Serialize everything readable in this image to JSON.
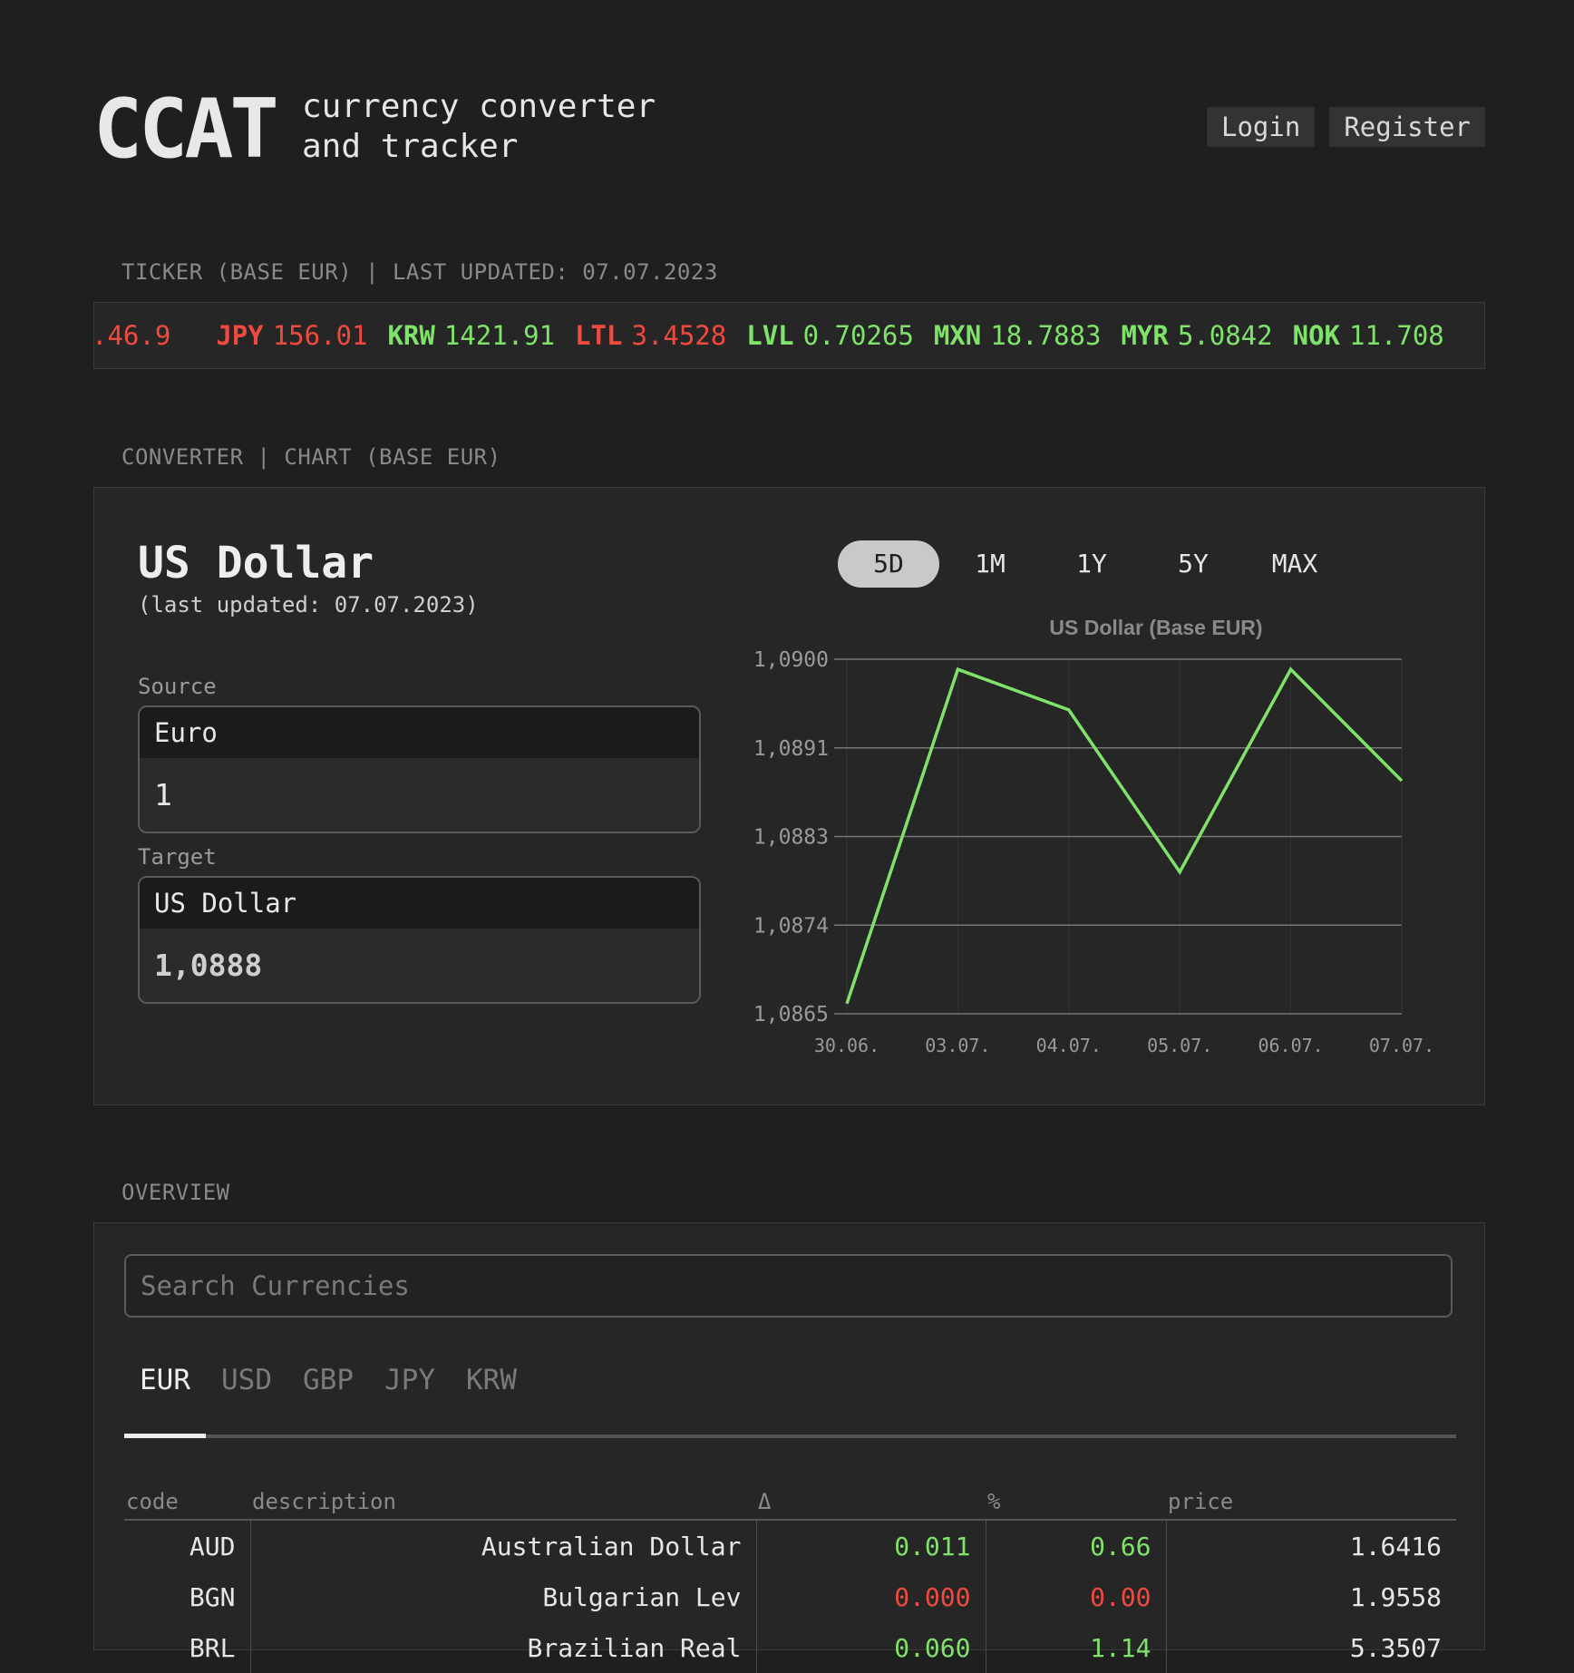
{
  "header": {
    "logo": "CCAT",
    "tagline_line1": "currency converter",
    "tagline_line2": "and tracker",
    "login_label": "Login",
    "register_label": "Register"
  },
  "ticker": {
    "label": "TICKER (BASE EUR) | LAST UPDATED: 07.07.2023",
    "items": [
      {
        "code": "",
        "rate": ".46.9",
        "trend": "down"
      },
      {
        "code": "JPY",
        "rate": "156.01",
        "trend": "down"
      },
      {
        "code": "KRW",
        "rate": "1421.91",
        "trend": "up"
      },
      {
        "code": "LTL",
        "rate": "3.4528",
        "trend": "down"
      },
      {
        "code": "LVL",
        "rate": "0.70265",
        "trend": "up"
      },
      {
        "code": "MXN",
        "rate": "18.7883",
        "trend": "up"
      },
      {
        "code": "MYR",
        "rate": "5.0842",
        "trend": "up"
      },
      {
        "code": "NOK",
        "rate": "11.708",
        "trend": "up"
      }
    ]
  },
  "converter": {
    "label": "CONVERTER | CHART (BASE EUR)",
    "title": "US Dollar",
    "updated": "(last updated: 07.07.2023)",
    "source_label": "Source",
    "source_currency": "Euro",
    "source_amount": "1",
    "target_label": "Target",
    "target_currency": "US Dollar",
    "target_amount": "1,0888",
    "range_tabs": [
      "5D",
      "1M",
      "1Y",
      "5Y",
      "MAX"
    ],
    "active_range": "5D"
  },
  "chart_data": {
    "type": "line",
    "title": "US Dollar (Base EUR)",
    "x": [
      "30.06.",
      "03.07.",
      "04.07.",
      "05.07.",
      "06.07.",
      "07.07."
    ],
    "series": [
      {
        "values": [
          1.0866,
          1.0899,
          1.0895,
          1.0879,
          1.0899,
          1.0888
        ]
      }
    ],
    "ylim": [
      1.0865,
      1.09
    ],
    "yticks": [
      "1,0865",
      "1,0874",
      "1,0883",
      "1,0891",
      "1,0900"
    ],
    "line_color": "#7fe36a",
    "grid": true
  },
  "overview": {
    "label": "OVERVIEW",
    "search_placeholder": "Search Currencies",
    "base_tabs": [
      "EUR",
      "USD",
      "GBP",
      "JPY",
      "KRW"
    ],
    "active_base": "EUR",
    "columns": [
      "code",
      "description",
      "Δ",
      "%",
      "price"
    ],
    "rows": [
      {
        "code": "AUD",
        "description": "Australian Dollar",
        "delta": "0.011",
        "pct": "0.66",
        "price": "1.6416",
        "trend": "up"
      },
      {
        "code": "BGN",
        "description": "Bulgarian Lev",
        "delta": "0.000",
        "pct": "0.00",
        "price": "1.9558",
        "trend": "down"
      },
      {
        "code": "BRL",
        "description": "Brazilian Real",
        "delta": "0.060",
        "pct": "1.14",
        "price": "5.3507",
        "trend": "up"
      }
    ]
  },
  "colors": {
    "background": "#1f1f1f",
    "panel": "#262626",
    "up": "#7fe36a",
    "down": "#f04a3e"
  }
}
